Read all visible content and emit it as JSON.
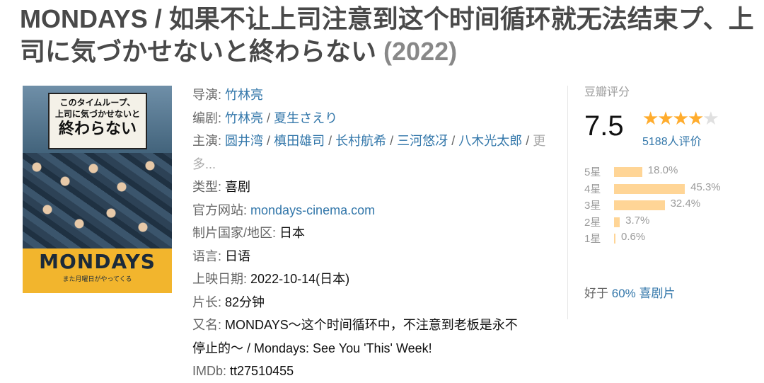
{
  "title": {
    "main": "MONDAYS / 如果不让上司注意到这个时间循环就无法结束プ、上司に気づかせないと終わらない",
    "year": "(2022)"
  },
  "poster": {
    "title_line1": "このタイムループ、",
    "title_line2": "上司に気づかせないと",
    "title_line3": "終わらない",
    "logo": "MONDAYS",
    "subtitle": "また月曜日がやってくる"
  },
  "info": {
    "director_label": "导演:",
    "director": "竹林亮",
    "writer_label": "编剧:",
    "writers": [
      "竹林亮",
      "夏生さえり"
    ],
    "cast_label": "主演:",
    "cast": [
      "圆井湾",
      "槙田雄司",
      "长村航希",
      "三河悠冴",
      "八木光太郎"
    ],
    "cast_more": "更多...",
    "genre_label": "类型:",
    "genre": "喜剧",
    "website_label": "官方网站:",
    "website": "mondays-cinema.com",
    "country_label": "制片国家/地区:",
    "country": "日本",
    "language_label": "语言:",
    "language": "日语",
    "release_label": "上映日期:",
    "release": "2022-10-14(日本)",
    "runtime_label": "片长:",
    "runtime": "82分钟",
    "aka_label": "又名:",
    "aka_line1": "MONDAYS～这个时间循环中，不注意到老板是永不",
    "aka_line2": "停止的～ / Mondays: See You 'This' Week!",
    "imdb_label": "IMDb:",
    "imdb": "tt27510455"
  },
  "rating": {
    "label": "豆瓣评分",
    "score": "7.5",
    "stars_filled": 4,
    "stars_total": 5,
    "votes": "5188人评价",
    "distribution": [
      {
        "label": "5星",
        "pct": "18.0%",
        "value": 18.0
      },
      {
        "label": "4星",
        "pct": "45.3%",
        "value": 45.3
      },
      {
        "label": "3星",
        "pct": "32.4%",
        "value": 32.4
      },
      {
        "label": "2星",
        "pct": "3.7%",
        "value": 3.7
      },
      {
        "label": "1星",
        "pct": "0.6%",
        "value": 0.6
      }
    ],
    "better_prefix": "好于",
    "better_value": "60% 喜剧片"
  },
  "colors": {
    "link": "#3377aa",
    "star": "#ffac2d",
    "bar": "#ffd596",
    "title": "#494949"
  }
}
